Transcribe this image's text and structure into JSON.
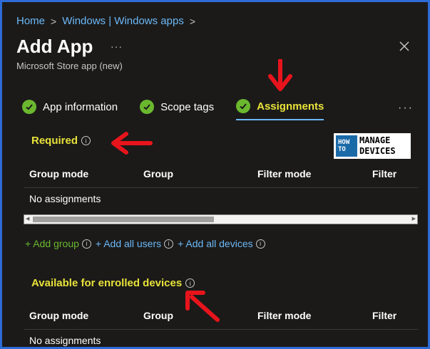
{
  "breadcrumb": {
    "items": [
      "Home",
      "Windows | Windows apps"
    ],
    "separator": ">"
  },
  "header": {
    "title": "Add App",
    "subtitle": "Microsoft Store app (new)",
    "more_label": "···",
    "close_icon": "close-icon"
  },
  "tabs": [
    {
      "label": "App information",
      "icon": "checkmark-icon",
      "active": false
    },
    {
      "label": "Scope tags",
      "icon": "checkmark-icon",
      "active": false
    },
    {
      "label": "Assignments",
      "icon": "checkmark-icon",
      "active": true
    }
  ],
  "tabs_more": "···",
  "sections": {
    "required": {
      "title": "Required",
      "columns": [
        "Group mode",
        "Group",
        "Filter mode",
        "Filter"
      ],
      "empty_text": "No assignments"
    },
    "available": {
      "title": "Available for enrolled devices",
      "columns": [
        "Group mode",
        "Group",
        "Filter mode",
        "Filter"
      ],
      "empty_text": "No assignments"
    }
  },
  "add_links": {
    "add_group": "+ Add group",
    "add_all_users": "+ Add all users",
    "add_all_devices": "+ Add all devices"
  },
  "logo": {
    "how_text": "HOW TO",
    "line1": "MANAGE",
    "line2": "DEVICES"
  },
  "colors": {
    "accent": "#6cb8f6",
    "highlight": "#e8e23a",
    "check_green": "#6bb82f",
    "annotation_red": "#e8141c",
    "frame_border": "#2d6bd6"
  }
}
